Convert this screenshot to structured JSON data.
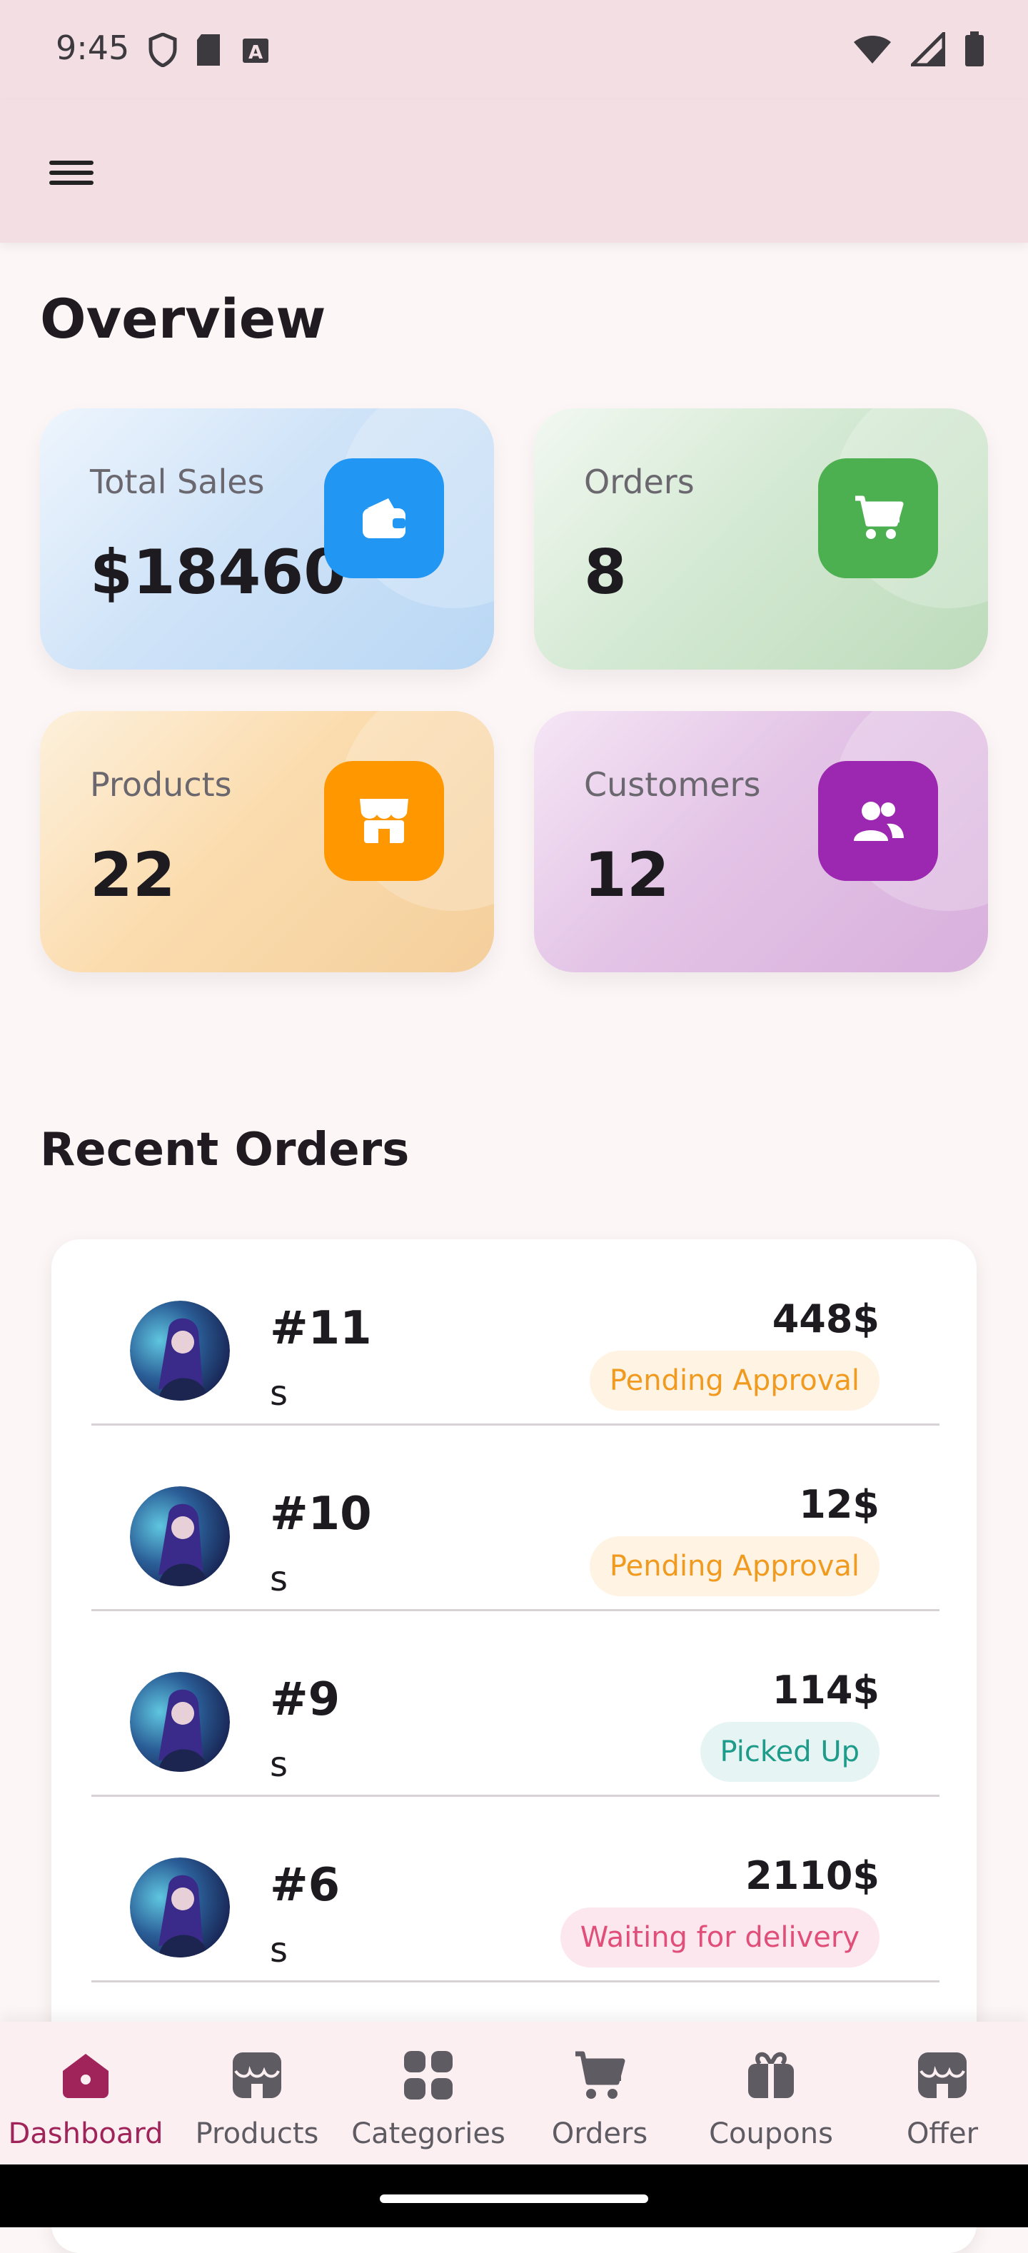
{
  "status_bar": {
    "time": "9:45"
  },
  "overview": {
    "title": "Overview",
    "cards": [
      {
        "label": "Total Sales",
        "value": "$18460",
        "icon": "wallet-icon",
        "color": "#2196f3"
      },
      {
        "label": "Orders",
        "value": "8",
        "icon": "cart-icon",
        "color": "#4caf50"
      },
      {
        "label": "Products",
        "value": "22",
        "icon": "store-icon",
        "color": "#ff9800"
      },
      {
        "label": "Customers",
        "value": "12",
        "icon": "people-icon",
        "color": "#9c27b0"
      }
    ]
  },
  "recent_orders": {
    "title": "Recent Orders",
    "items": [
      {
        "id": "#11",
        "customer": "s",
        "total": "448$",
        "status": "Pending Approval",
        "status_fg": "#f09a1f",
        "status_bg": "#fff4e4"
      },
      {
        "id": "#10",
        "customer": "s",
        "total": "12$",
        "status": "Pending Approval",
        "status_fg": "#f09a1f",
        "status_bg": "#fff4e4"
      },
      {
        "id": "#9",
        "customer": "s",
        "total": "114$",
        "status": "Picked Up",
        "status_fg": "#1e9b8a",
        "status_bg": "#e6f5f3"
      },
      {
        "id": "#6",
        "customer": "s",
        "total": "2110$",
        "status": "Waiting for delivery",
        "status_fg": "#e04f7a",
        "status_bg": "#fde7ee"
      }
    ]
  },
  "bottom_nav": {
    "items": [
      {
        "label": "Dashboard",
        "icon": "home-icon",
        "active": true
      },
      {
        "label": "Products",
        "icon": "store-icon",
        "active": false
      },
      {
        "label": "Categories",
        "icon": "grid-icon",
        "active": false
      },
      {
        "label": "Orders",
        "icon": "cart-icon",
        "active": false
      },
      {
        "label": "Coupons",
        "icon": "gift-icon",
        "active": false
      },
      {
        "label": "Offer",
        "icon": "store-icon",
        "active": false
      }
    ]
  },
  "colors": {
    "accent": "#a0245a",
    "app_bar": "#f3dfe3",
    "background": "#fdf6f7"
  }
}
